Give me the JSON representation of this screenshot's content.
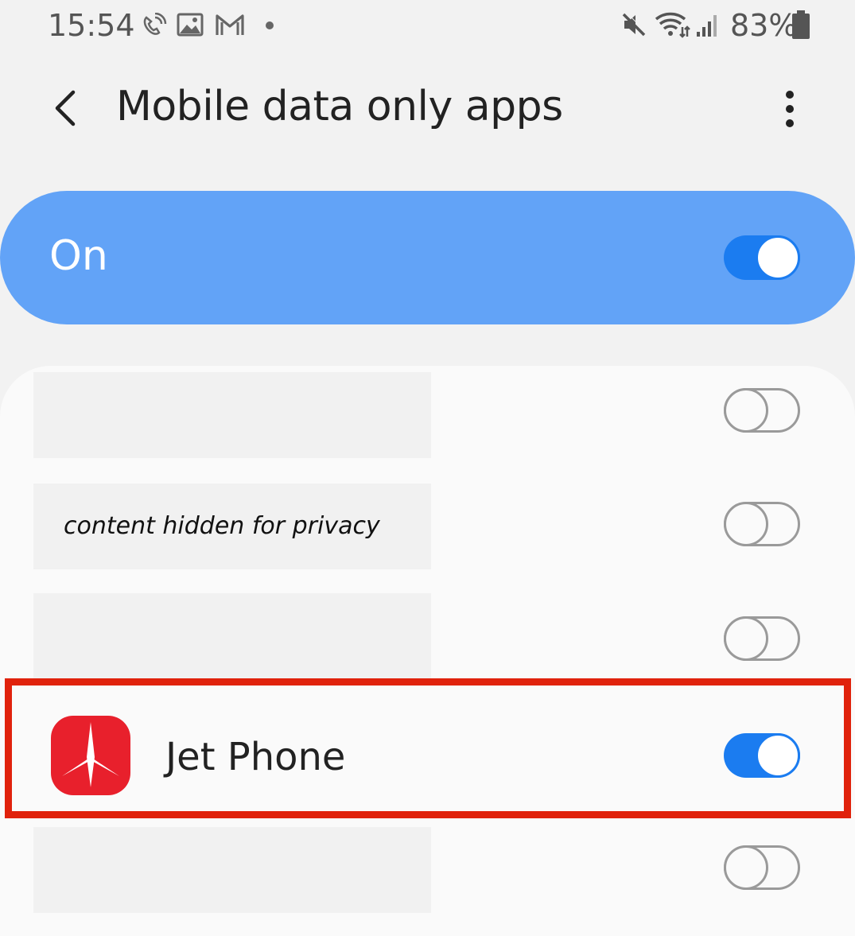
{
  "status_bar": {
    "time": "15:54",
    "battery": "83%",
    "left_icons": [
      "call-icon",
      "image-icon",
      "gmail-icon",
      "dot-icon"
    ],
    "right_icons": [
      "mute-icon",
      "wifi-icon",
      "signal-icon",
      "battery-icon"
    ]
  },
  "header": {
    "title": "Mobile data only apps",
    "back_icon": "chevron-left-icon",
    "more_icon": "more-vertical-icon"
  },
  "master_switch": {
    "label": "On",
    "enabled": true,
    "color": "#62a3f7"
  },
  "apps": [
    {
      "name": "",
      "privacy_note": "",
      "enabled": false
    },
    {
      "name": "",
      "privacy_note": "content hidden for privacy",
      "enabled": false
    },
    {
      "name": "",
      "privacy_note": "",
      "enabled": false
    },
    {
      "name": "Jet Phone",
      "icon": "jet-phone-app-icon",
      "enabled": true,
      "highlighted": true
    },
    {
      "name": "",
      "privacy_note": "",
      "enabled": false
    }
  ],
  "colors": {
    "accent": "#1b7cf0",
    "highlight": "#e0220c",
    "app_icon": "#e8202c"
  }
}
